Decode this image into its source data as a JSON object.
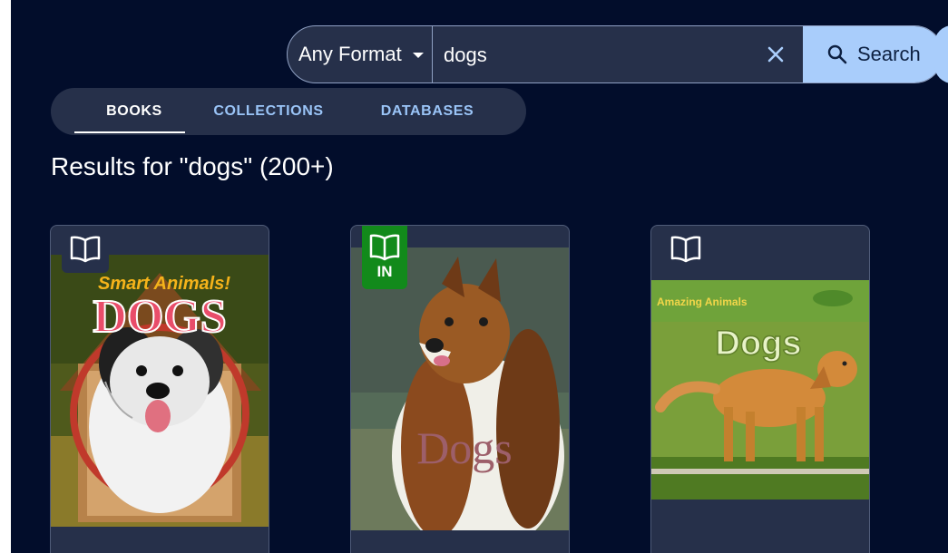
{
  "search": {
    "format_label": "Any Format",
    "query": "dogs",
    "button_label": "Search"
  },
  "tabs": [
    {
      "label": "BOOKS",
      "active": true
    },
    {
      "label": "COLLECTIONS",
      "active": false
    },
    {
      "label": "DATABASES",
      "active": false
    }
  ],
  "results": {
    "heading": "Results for \"dogs\" (200+)"
  },
  "books": [
    {
      "badge_icon": "open-book-icon",
      "cover_texts": [
        "Smart Animals!",
        "DOGS"
      ]
    },
    {
      "badge_icon": "open-book-icon",
      "badge_label": "IN",
      "cover_texts": [
        "Dogs"
      ]
    },
    {
      "badge_icon": "open-book-icon",
      "cover_texts": [
        "Amazing Animals",
        "Dogs"
      ]
    }
  ],
  "colors": {
    "background": "#020d2b",
    "panel": "#26304a",
    "accent": "#a9cdfb",
    "tab_inactive": "#9ac4f7",
    "badge_in": "#128a1b"
  }
}
